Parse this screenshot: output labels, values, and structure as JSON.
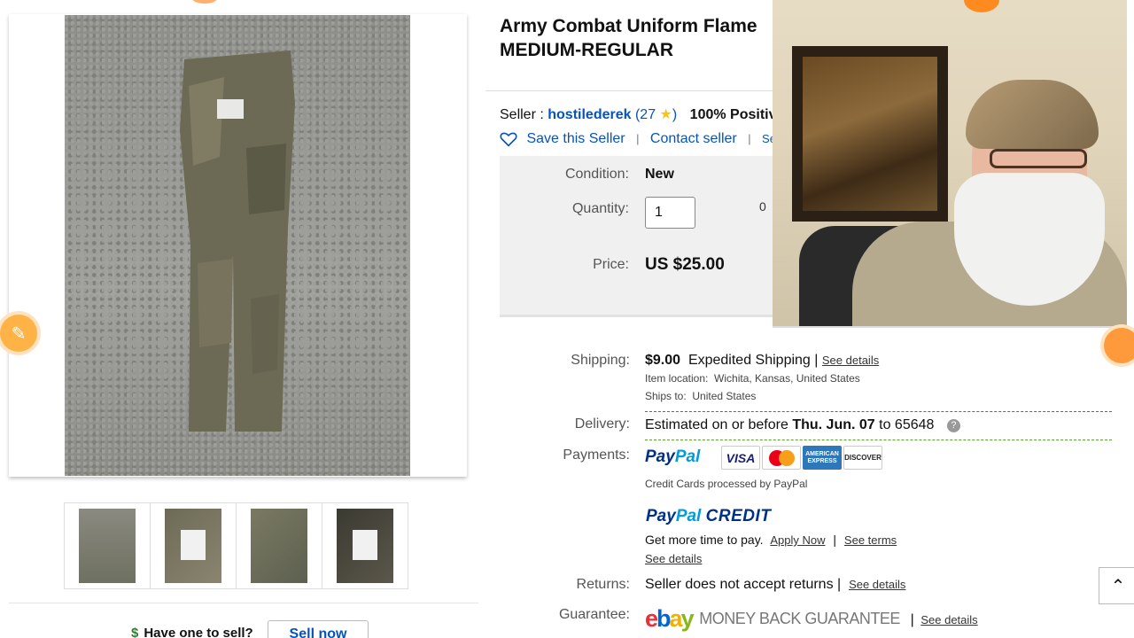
{
  "listing": {
    "title_line1": "Army Combat Uniform Flame",
    "title_line2": "MEDIUM-REGULAR"
  },
  "seller": {
    "prefix": "Seller :",
    "name": "hostilederek",
    "score_open": "(27",
    "score_close": ")",
    "positive": "100% Positiv",
    "save_label": "Save this Seller",
    "contact_label": "Contact seller",
    "see_label": "Se",
    "separator": "|"
  },
  "purchase": {
    "condition_label": "Condition:",
    "condition_value": "New",
    "quantity_label": "Quantity:",
    "quantity_value": "1",
    "available_fragment": "0",
    "price_label": "Price:",
    "price_value": "US $25.00"
  },
  "shipping": {
    "label": "Shipping:",
    "cost": "$9.00",
    "method": "Expedited Shipping",
    "separator": "|",
    "see_details": "See details",
    "item_location_label": "Item location:",
    "item_location": "Wichita, Kansas, United States",
    "ships_to_label": "Ships to:",
    "ships_to": "United States"
  },
  "delivery": {
    "label": "Delivery:",
    "prefix": "Estimated on or before",
    "date": "Thu. Jun. 07",
    "to": "to",
    "zip": "65648",
    "help": "?"
  },
  "payments": {
    "label": "Payments:",
    "paypal_a": "Pay",
    "paypal_b": "Pal",
    "cards": [
      "VISA",
      "AMERICAN EXPRESS",
      "DISCOVER"
    ],
    "note": "Credit Cards processed by PayPal",
    "credit_a": "Pay",
    "credit_b": "Pal",
    "credit_c": "CREDIT",
    "more_time": "Get more time to pay.",
    "apply_now": "Apply Now",
    "separator": "|",
    "see_terms": "See terms",
    "see_details": "See details"
  },
  "returns": {
    "label": "Returns:",
    "text": "Seller does not accept returns",
    "separator": "|",
    "see_details": "See details"
  },
  "guarantee": {
    "label": "Guarantee:",
    "ebay_e": "e",
    "ebay_b": "b",
    "ebay_a": "a",
    "ebay_y": "y",
    "mbg": "MONEY BACK GUARANTEE",
    "separator": "|",
    "see_details": "See details"
  },
  "sell": {
    "prompt": "Have one to sell?",
    "button": "Sell now",
    "dollar": "$"
  },
  "colors": {
    "link_blue": "#0654ba",
    "paypal_dark": "#003087",
    "paypal_light": "#009cde",
    "overlay_orange": "#ff9a3c"
  },
  "icons": {
    "save": "heart-icon",
    "help": "help-icon",
    "scroll": "chevron-up-icon",
    "star": "star-icon"
  }
}
